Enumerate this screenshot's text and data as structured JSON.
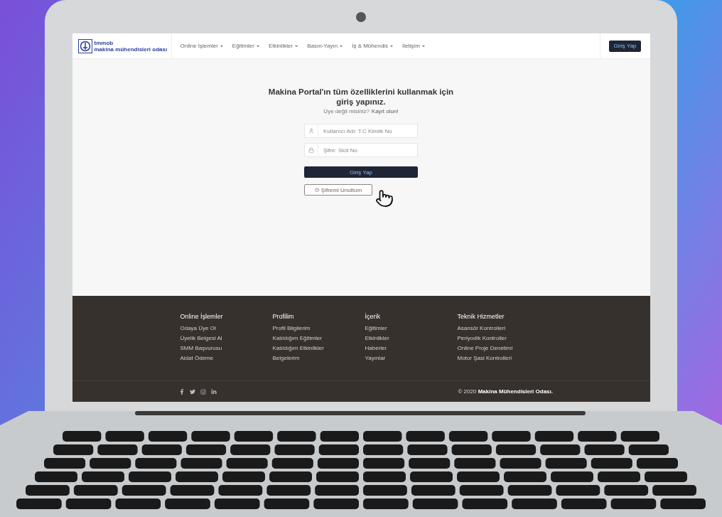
{
  "nav": {
    "logo": {
      "line_1": "tmmob",
      "line_2": "makina mühendisleri odası"
    },
    "menu": [
      {
        "label": "Online İşlemler"
      },
      {
        "label": "Eğitimler"
      },
      {
        "label": "Etkinlikler"
      },
      {
        "label": "Basın-Yayın"
      },
      {
        "label": "İş & Mühendis"
      },
      {
        "label": "İletişim"
      }
    ],
    "login_button": "Giriş Yap"
  },
  "login": {
    "title": "Makina Portal'ın tüm özelliklerini kullanmak için giriş yapınız.",
    "subtitle": "Üye değil misiniz?",
    "register_link": "Kayıt olun!",
    "fields": [
      {
        "kind": "user",
        "placeholder": "Kullanıcı Adı: T.C Kimlik No"
      },
      {
        "kind": "password",
        "placeholder": "Şifre: Sicil No"
      }
    ],
    "submit": "Giriş Yap",
    "forgot": "Şifremi Unuttum"
  },
  "footer": {
    "columns": [
      {
        "heading": "Online İşlemler",
        "links": [
          "Odaya Üye Ol",
          "Üyelik Belgesi Al",
          "SMM Başvurusu",
          "Aidat Ödeme"
        ]
      },
      {
        "heading": "Profilim",
        "links": [
          "Profil Bilgilerim",
          "Katıldığım Eğitimler",
          "Katıldığım Etkinlikler",
          "Belgelerim"
        ]
      },
      {
        "heading": "İçerik",
        "links": [
          "Eğitimler",
          "Etkinlikler",
          "Haberler",
          "Yayınlar"
        ]
      },
      {
        "heading": "Teknik Hizmetler",
        "links": [
          "Asansör Kontrolleri",
          "Periyodik Kontroller",
          "Online Proje Denetimi",
          "Motor Şasi Kontrolleri"
        ]
      }
    ],
    "social": [
      {
        "kind": "facebook"
      },
      {
        "kind": "twitter"
      },
      {
        "kind": "instagram"
      },
      {
        "kind": "linkedin"
      }
    ],
    "copyright": "© 2020 **Makina Mühendisleri Odası.**"
  }
}
